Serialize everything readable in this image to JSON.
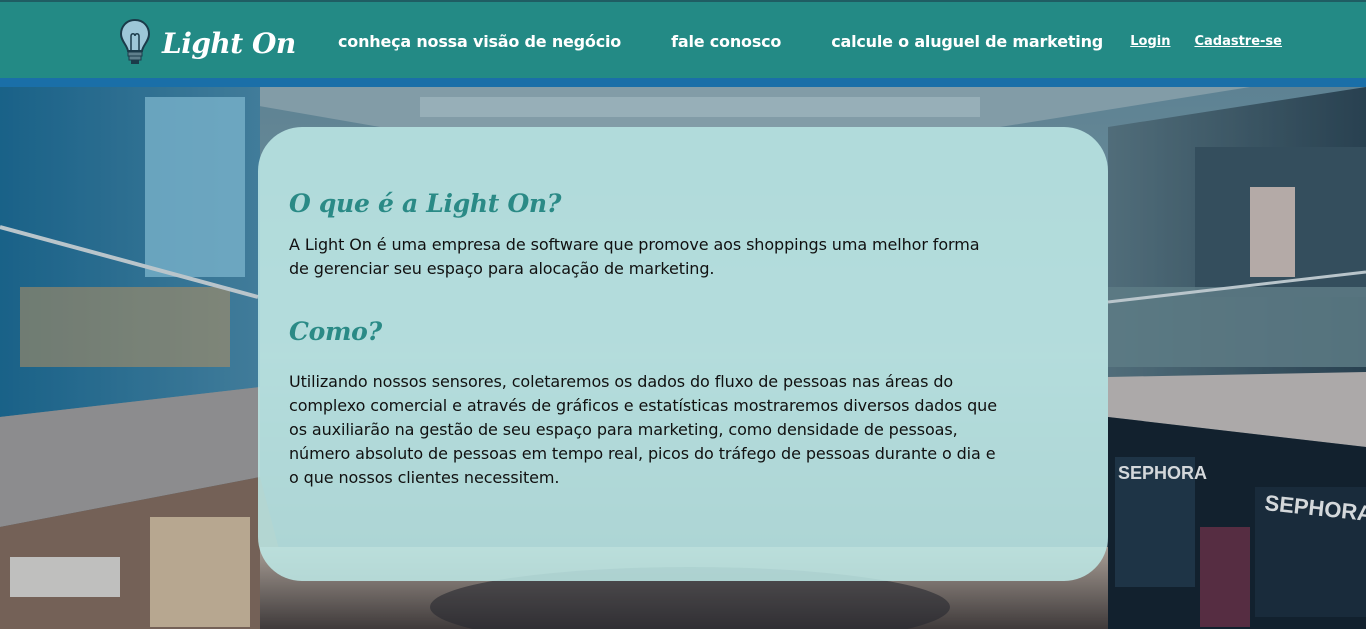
{
  "header": {
    "brand_name": "Light On",
    "brand_icon": "lightbulb-icon",
    "nav_links": [
      "conheça nossa visão de negócio",
      "fale conosco",
      "calcule o aluguel de marketing"
    ],
    "login_label": "Login",
    "signup_label": "Cadastre-se"
  },
  "hero": {
    "storefront_signs": [
      "SEPHORA",
      "SEPHORA"
    ]
  },
  "content": {
    "section1": {
      "title": "O que é a Light On?",
      "text": "A Light On é uma empresa de software que promove aos shoppings uma melhor forma de gerenciar seu espaço para alocação de marketing."
    },
    "section2": {
      "title": "Como?",
      "text": "Utilizando nossos sensores, coletaremos os dados do fluxo de pessoas nas áreas do complexo comercial e através de gráficos e estatísticas mostraremos diversos dados que os auxiliarão na gestão de seu espaço para marketing, como densidade de pessoas, número absoluto de pessoas em tempo real, picos do tráfego de pessoas durante o dia e o que nossos clientes necessitem."
    }
  },
  "colors": {
    "header_bg": "#238a85",
    "header_stripe": "#1a6fa8",
    "card_bg": "#bee9e6",
    "heading": "#2a8a86"
  }
}
